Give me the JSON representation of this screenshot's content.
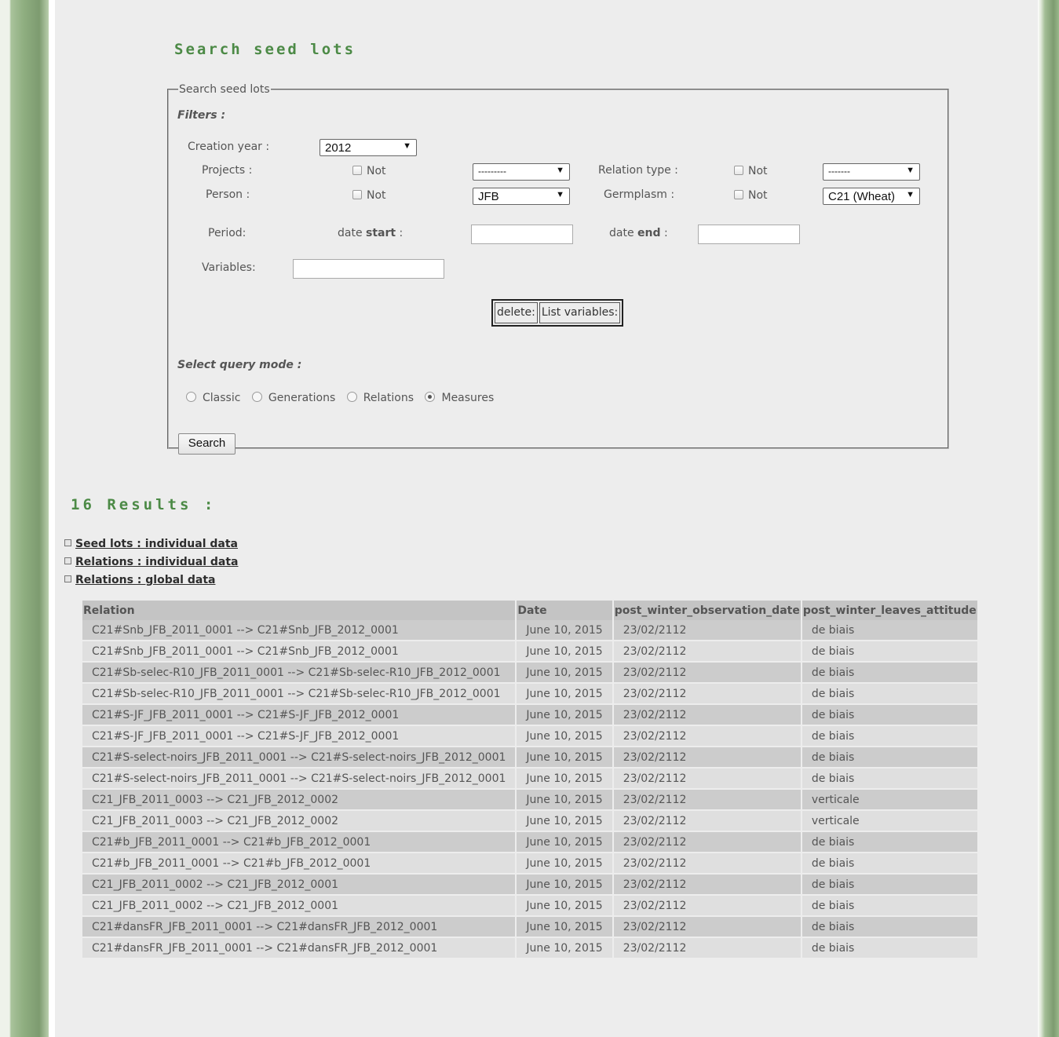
{
  "page_title": "Search seed lots",
  "form": {
    "legend": "Search seed lots",
    "filters_label": "Filters :",
    "creation_year": {
      "label": "Creation year :",
      "value": "2012"
    },
    "projects": {
      "label": "Projects :",
      "not_label": "Not",
      "value": "---------"
    },
    "relation_type": {
      "label": "Relation type :",
      "not_label": "Not",
      "value": "-------"
    },
    "person": {
      "label": "Person :",
      "not_label": "Not",
      "value": "JFB"
    },
    "germplasm": {
      "label": "Germplasm :",
      "not_label": "Not",
      "value": "C21 (Wheat)"
    },
    "period": {
      "label": "Period:",
      "start_prefix": "date ",
      "start_bold": "start",
      "start_suffix": " :",
      "end_prefix": "date ",
      "end_bold": "end",
      "end_suffix": " :",
      "start_value": "",
      "end_value": ""
    },
    "variables": {
      "label": "Variables:",
      "value": ""
    },
    "delete_button": "delete:",
    "list_variables_button": "List variables:",
    "query_mode_label": "Select query mode :",
    "query_modes": [
      "Classic",
      "Generations",
      "Relations",
      "Measures"
    ],
    "selected_mode": "Measures",
    "search_button": "Search"
  },
  "results": {
    "heading": "16 Results :",
    "links": [
      "Seed lots : individual data",
      "Relations : individual data",
      "Relations : global data"
    ],
    "columns": [
      "Relation",
      "Date",
      "post_winter_observation_date",
      "post_winter_leaves_attitude"
    ],
    "rows": [
      [
        "C21#Snb_JFB_2011_0001 --> C21#Snb_JFB_2012_0001",
        "June 10, 2015",
        "23/02/2112",
        "de biais"
      ],
      [
        "C21#Snb_JFB_2011_0001 --> C21#Snb_JFB_2012_0001",
        "June 10, 2015",
        "23/02/2112",
        "de biais"
      ],
      [
        "C21#Sb-selec-R10_JFB_2011_0001 --> C21#Sb-selec-R10_JFB_2012_0001",
        "June 10, 2015",
        "23/02/2112",
        "de biais"
      ],
      [
        "C21#Sb-selec-R10_JFB_2011_0001 --> C21#Sb-selec-R10_JFB_2012_0001",
        "June 10, 2015",
        "23/02/2112",
        "de biais"
      ],
      [
        "C21#S-JF_JFB_2011_0001 --> C21#S-JF_JFB_2012_0001",
        "June 10, 2015",
        "23/02/2112",
        "de biais"
      ],
      [
        "C21#S-JF_JFB_2011_0001 --> C21#S-JF_JFB_2012_0001",
        "June 10, 2015",
        "23/02/2112",
        "de biais"
      ],
      [
        "C21#S-select-noirs_JFB_2011_0001 --> C21#S-select-noirs_JFB_2012_0001",
        "June 10, 2015",
        "23/02/2112",
        "de biais"
      ],
      [
        "C21#S-select-noirs_JFB_2011_0001 --> C21#S-select-noirs_JFB_2012_0001",
        "June 10, 2015",
        "23/02/2112",
        "de biais"
      ],
      [
        "C21_JFB_2011_0003 --> C21_JFB_2012_0002",
        "June 10, 2015",
        "23/02/2112",
        "verticale"
      ],
      [
        "C21_JFB_2011_0003 --> C21_JFB_2012_0002",
        "June 10, 2015",
        "23/02/2112",
        "verticale"
      ],
      [
        "C21#b_JFB_2011_0001 --> C21#b_JFB_2012_0001",
        "June 10, 2015",
        "23/02/2112",
        "de biais"
      ],
      [
        "C21#b_JFB_2011_0001 --> C21#b_JFB_2012_0001",
        "June 10, 2015",
        "23/02/2112",
        "de biais"
      ],
      [
        "C21_JFB_2011_0002 --> C21_JFB_2012_0001",
        "June 10, 2015",
        "23/02/2112",
        "de biais"
      ],
      [
        "C21_JFB_2011_0002 --> C21_JFB_2012_0001",
        "June 10, 2015",
        "23/02/2112",
        "de biais"
      ],
      [
        "C21#dansFR_JFB_2011_0001 --> C21#dansFR_JFB_2012_0001",
        "June 10, 2015",
        "23/02/2112",
        "de biais"
      ],
      [
        "C21#dansFR_JFB_2011_0001 --> C21#dansFR_JFB_2012_0001",
        "June 10, 2015",
        "23/02/2112",
        "de biais"
      ]
    ]
  }
}
